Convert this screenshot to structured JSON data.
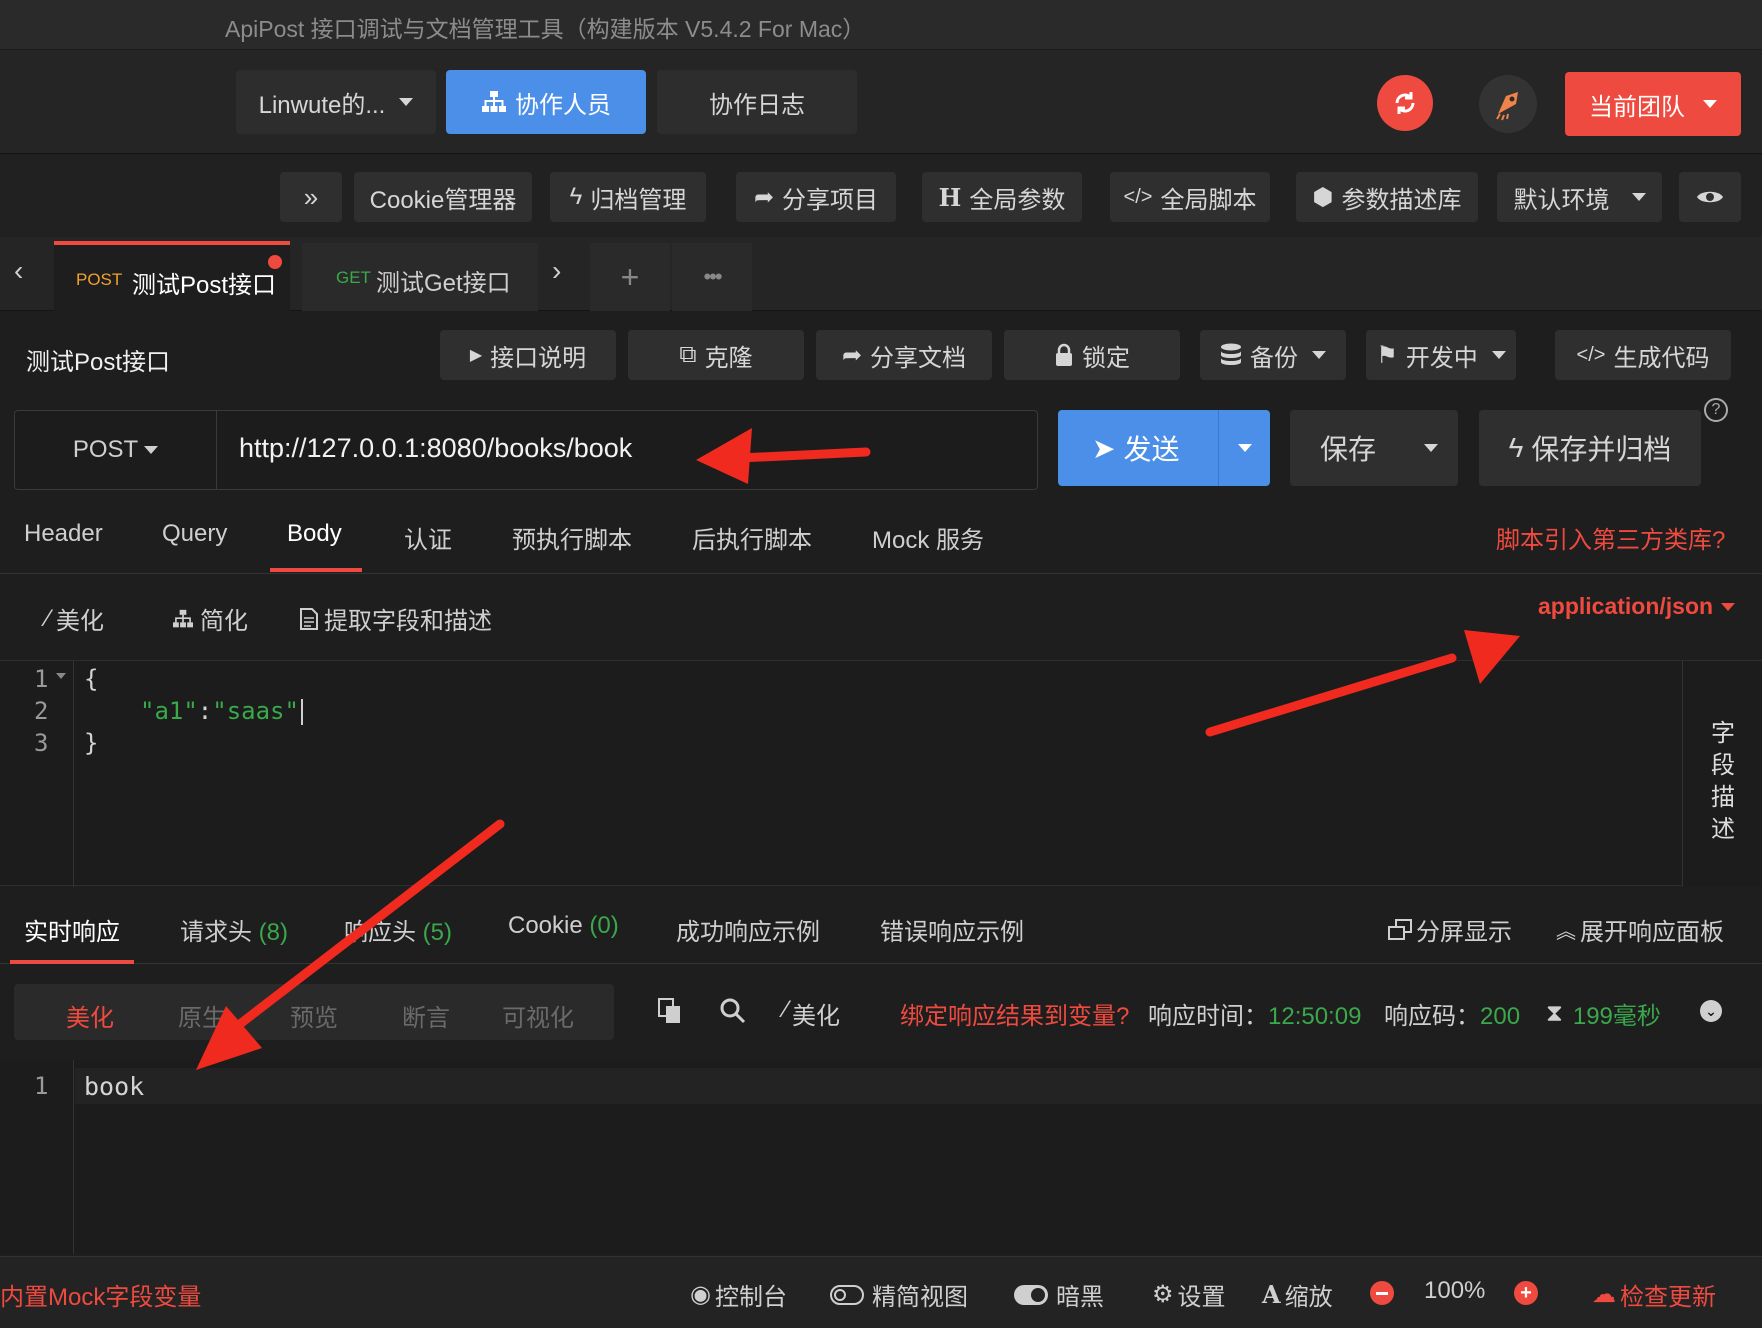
{
  "window": {
    "title": "ApiPost 接口调试与文档管理工具（构建版本 V5.4.2 For Mac）"
  },
  "header": {
    "team_select": "Linwute的...",
    "collaborators": "协作人员",
    "collab_log": "协作日志",
    "current_team": "当前团队"
  },
  "toolbar": {
    "more": "»",
    "items": [
      "Cookie管理器",
      "归档管理",
      "分享项目",
      "全局参数",
      "全局脚本",
      "参数描述库",
      "默认环境"
    ]
  },
  "tabs": [
    {
      "method": "POST",
      "name": "测试Post接口",
      "active": true,
      "unsaved": true
    },
    {
      "method": "GET",
      "name": "测试Get接口",
      "active": false
    }
  ],
  "request": {
    "title": "测试Post接口",
    "actions": [
      "接口说明",
      "克隆",
      "分享文档",
      "锁定",
      "备份",
      "开发中",
      "生成代码"
    ],
    "method": "POST",
    "url": "http://127.0.0.1:8080/books/book",
    "send": "发送",
    "save": "保存",
    "save_archive": "保存并归档"
  },
  "req_tabs": {
    "items": [
      "Header",
      "Query",
      "Body",
      "认证",
      "预执行脚本",
      "后执行脚本",
      "Mock 服务"
    ],
    "active": "Body",
    "third_party_link": "脚本引入第三方类库?"
  },
  "body_tools": {
    "beautify": "美化",
    "simplify": "简化",
    "extract": "提取字段和描述",
    "content_type": "application/json"
  },
  "editor": {
    "lines": [
      "1",
      "2",
      "3"
    ],
    "code": {
      "open": "{",
      "key": "\"a1\"",
      "colon": ":",
      "value": "\"saas\"",
      "close": "}"
    },
    "side_label": [
      "字",
      "段",
      "描",
      "述"
    ]
  },
  "response_tabs": {
    "realtime": "实时响应",
    "req_headers": "请求头",
    "req_headers_count": "(8)",
    "resp_headers": "响应头",
    "resp_headers_count": "(5)",
    "cookie": "Cookie",
    "cookie_count": "(0)",
    "success_example": "成功响应示例",
    "error_example": "错误响应示例",
    "split_view": "分屏显示",
    "expand_panel": "展开响应面板"
  },
  "response_view": {
    "modes": [
      "美化",
      "原生",
      "预览",
      "断言",
      "可视化"
    ],
    "active_mode": "美化",
    "beautify": "美化",
    "bind_link": "绑定响应结果到变量?",
    "time_label": "响应时间：",
    "time_value": "12:50:09",
    "code_label": "响应码：",
    "code_value": "200",
    "duration": "199毫秒"
  },
  "response_body": {
    "lines": [
      "1"
    ],
    "text": "book"
  },
  "statusbar": {
    "mock_link": "内置Mock字段变量",
    "console": "控制台",
    "compact_view": "精简视图",
    "dark": "暗黑",
    "settings": "设置",
    "zoom": "缩放",
    "zoom_value": "100%",
    "check_update": "检查更新"
  },
  "colors": {
    "accent_red": "#ef4a3f",
    "accent_blue": "#4b8fe8",
    "green": "#3aa84b",
    "bg": "#1e1e1e"
  }
}
